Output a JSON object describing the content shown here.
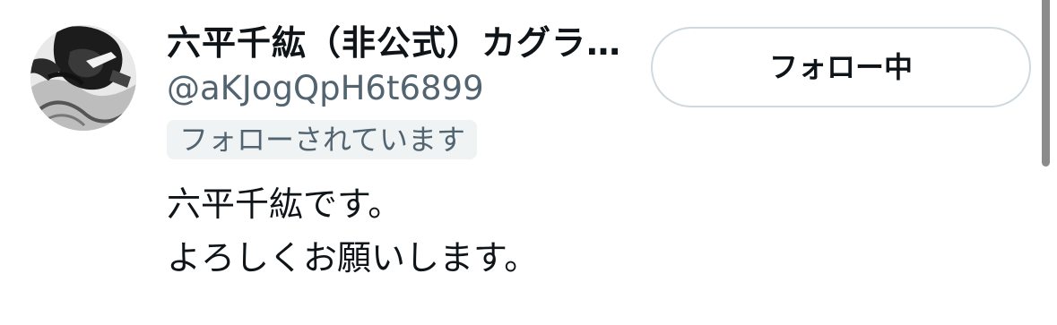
{
  "user": {
    "display_name": "六平千紘（非公式）カグラ…",
    "handle": "@aKJogQpH6t6899",
    "follows_you": "フォローされています",
    "bio_lines": [
      "六平千紘です。",
      "よろしくお願いします。"
    ]
  },
  "follow_button": {
    "label": "フォロー中"
  },
  "colors": {
    "text_primary": "#0f1419",
    "text_secondary": "#536471",
    "badge_background": "#eff3f4",
    "button_border": "#cfd9de",
    "scrollbar": "#8b8b8b"
  },
  "icons": {
    "avatar": "manga-character-avatar"
  }
}
